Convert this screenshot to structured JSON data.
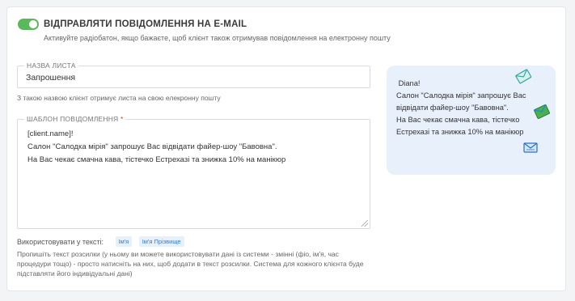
{
  "toggle": {
    "title": "ВІДПРАВЛЯТИ ПОВІДОМЛЕННЯ НА E-MAIL",
    "hint": "Активуйте радіобатон, якщо бажаєте, щоб клієнт також отримував повідомлення на електронну пошту",
    "enabled": true,
    "on_color": "#5cb85c"
  },
  "subject": {
    "legend": "НАЗВА ЛИСТА",
    "value": "Запрошення",
    "hint": "З такою назвою клієнт отримує листа на свою елекронну пошту"
  },
  "template": {
    "legend": "ШАБЛОН ПОВІДОМЛЕННЯ",
    "required_mark": "*",
    "value": "[client.name]!\nСалон \"Салодка мірія\" запрошує Вас відвідати файер-шоу \"Бавовна\".\nНа Вас чекає смачна кава, тістечко Естрехазі та знижка 10% на манікюр"
  },
  "variables": {
    "label": "Використовувати у тексті:",
    "chips": [
      "Ім'я",
      "Ім'я Прізвище"
    ]
  },
  "help": "Пропишіть текст розсилки (у ньому ви можете використовувати дані із системи - змінні (фіо, ім'я, час процедури тощо) - просто натисніть на них, щоб додати в текст розсилки. Система для кожного клієнта буде підставляти його індивідуальні дані)",
  "preview": {
    "text": " Diana!\nСалон \"Салодка мірія\" запрошує Вас відвідати файер-шоу \"Бавовна\".\nНа Вас чекає смачна кава, тістечко Естрехазі та знижка 10% на манікюр",
    "background": "#e8f0fb"
  }
}
